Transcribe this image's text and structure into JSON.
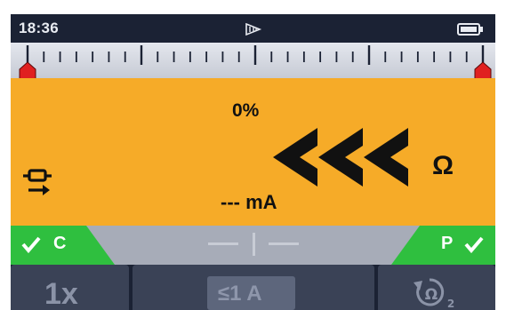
{
  "status_bar": {
    "time": "18:36",
    "signal_icon": "wireless-sweep-icon",
    "battery_icon": "battery-icon"
  },
  "scale": {
    "left_marker_icon": "range-marker-left-icon",
    "right_marker_icon": "range-marker-right-icon"
  },
  "measurement": {
    "percent": "0%",
    "value_symbol": "<<<",
    "unit": "Ω",
    "current": "--- mA",
    "mode_icon": "test-leads-icon"
  },
  "status_strip": {
    "left_badge": "C",
    "right_badge": "P",
    "reading_left": "——",
    "reading_right": "——"
  },
  "softkeys": {
    "multiplier": "1x",
    "current_limit": "≤1 A",
    "zero_icon": "null-ohm-2-icon"
  },
  "colors": {
    "screen_bg": "#1b2234",
    "main_bg": "#f6ab28",
    "badge_green": "#2fbf3f",
    "marker_red": "#e02020",
    "softkey_bg": "#3a4256"
  }
}
